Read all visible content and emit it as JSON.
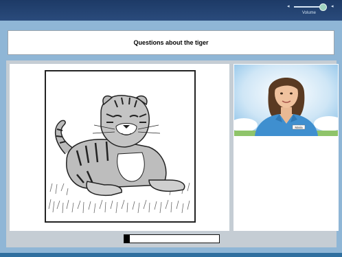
{
  "volume": {
    "label": "Volume",
    "level": 0.9
  },
  "title": "Questions about the tiger",
  "avatar": {
    "name_tag": "Maria"
  },
  "progress": {
    "fraction": 0.06
  }
}
